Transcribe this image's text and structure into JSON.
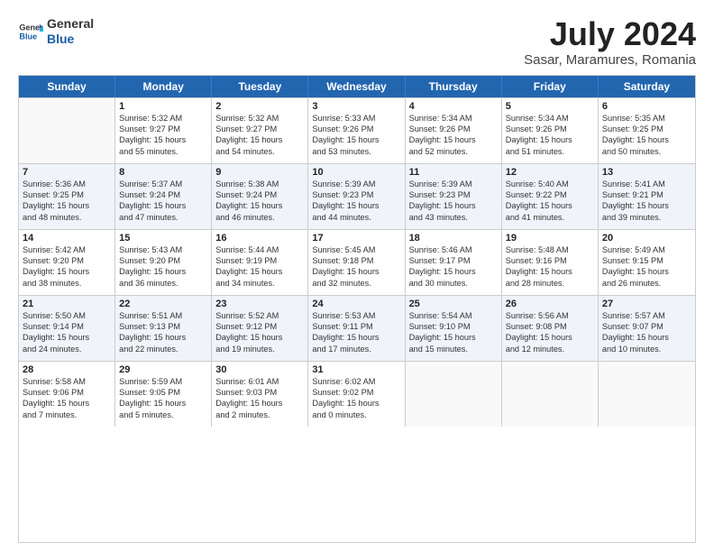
{
  "header": {
    "logo_line1": "General",
    "logo_line2": "Blue",
    "title": "July 2024",
    "subtitle": "Sasar, Maramures, Romania"
  },
  "weekdays": [
    "Sunday",
    "Monday",
    "Tuesday",
    "Wednesday",
    "Thursday",
    "Friday",
    "Saturday"
  ],
  "weeks": [
    [
      {
        "day": "",
        "lines": [],
        "empty": true
      },
      {
        "day": "1",
        "lines": [
          "Sunrise: 5:32 AM",
          "Sunset: 9:27 PM",
          "Daylight: 15 hours",
          "and 55 minutes."
        ]
      },
      {
        "day": "2",
        "lines": [
          "Sunrise: 5:32 AM",
          "Sunset: 9:27 PM",
          "Daylight: 15 hours",
          "and 54 minutes."
        ]
      },
      {
        "day": "3",
        "lines": [
          "Sunrise: 5:33 AM",
          "Sunset: 9:26 PM",
          "Daylight: 15 hours",
          "and 53 minutes."
        ]
      },
      {
        "day": "4",
        "lines": [
          "Sunrise: 5:34 AM",
          "Sunset: 9:26 PM",
          "Daylight: 15 hours",
          "and 52 minutes."
        ]
      },
      {
        "day": "5",
        "lines": [
          "Sunrise: 5:34 AM",
          "Sunset: 9:26 PM",
          "Daylight: 15 hours",
          "and 51 minutes."
        ]
      },
      {
        "day": "6",
        "lines": [
          "Sunrise: 5:35 AM",
          "Sunset: 9:25 PM",
          "Daylight: 15 hours",
          "and 50 minutes."
        ]
      }
    ],
    [
      {
        "day": "7",
        "lines": [
          "Sunrise: 5:36 AM",
          "Sunset: 9:25 PM",
          "Daylight: 15 hours",
          "and 48 minutes."
        ],
        "alt": true
      },
      {
        "day": "8",
        "lines": [
          "Sunrise: 5:37 AM",
          "Sunset: 9:24 PM",
          "Daylight: 15 hours",
          "and 47 minutes."
        ],
        "alt": true
      },
      {
        "day": "9",
        "lines": [
          "Sunrise: 5:38 AM",
          "Sunset: 9:24 PM",
          "Daylight: 15 hours",
          "and 46 minutes."
        ],
        "alt": true
      },
      {
        "day": "10",
        "lines": [
          "Sunrise: 5:39 AM",
          "Sunset: 9:23 PM",
          "Daylight: 15 hours",
          "and 44 minutes."
        ],
        "alt": true
      },
      {
        "day": "11",
        "lines": [
          "Sunrise: 5:39 AM",
          "Sunset: 9:23 PM",
          "Daylight: 15 hours",
          "and 43 minutes."
        ],
        "alt": true
      },
      {
        "day": "12",
        "lines": [
          "Sunrise: 5:40 AM",
          "Sunset: 9:22 PM",
          "Daylight: 15 hours",
          "and 41 minutes."
        ],
        "alt": true
      },
      {
        "day": "13",
        "lines": [
          "Sunrise: 5:41 AM",
          "Sunset: 9:21 PM",
          "Daylight: 15 hours",
          "and 39 minutes."
        ],
        "alt": true
      }
    ],
    [
      {
        "day": "14",
        "lines": [
          "Sunrise: 5:42 AM",
          "Sunset: 9:20 PM",
          "Daylight: 15 hours",
          "and 38 minutes."
        ]
      },
      {
        "day": "15",
        "lines": [
          "Sunrise: 5:43 AM",
          "Sunset: 9:20 PM",
          "Daylight: 15 hours",
          "and 36 minutes."
        ]
      },
      {
        "day": "16",
        "lines": [
          "Sunrise: 5:44 AM",
          "Sunset: 9:19 PM",
          "Daylight: 15 hours",
          "and 34 minutes."
        ]
      },
      {
        "day": "17",
        "lines": [
          "Sunrise: 5:45 AM",
          "Sunset: 9:18 PM",
          "Daylight: 15 hours",
          "and 32 minutes."
        ]
      },
      {
        "day": "18",
        "lines": [
          "Sunrise: 5:46 AM",
          "Sunset: 9:17 PM",
          "Daylight: 15 hours",
          "and 30 minutes."
        ]
      },
      {
        "day": "19",
        "lines": [
          "Sunrise: 5:48 AM",
          "Sunset: 9:16 PM",
          "Daylight: 15 hours",
          "and 28 minutes."
        ]
      },
      {
        "day": "20",
        "lines": [
          "Sunrise: 5:49 AM",
          "Sunset: 9:15 PM",
          "Daylight: 15 hours",
          "and 26 minutes."
        ]
      }
    ],
    [
      {
        "day": "21",
        "lines": [
          "Sunrise: 5:50 AM",
          "Sunset: 9:14 PM",
          "Daylight: 15 hours",
          "and 24 minutes."
        ],
        "alt": true
      },
      {
        "day": "22",
        "lines": [
          "Sunrise: 5:51 AM",
          "Sunset: 9:13 PM",
          "Daylight: 15 hours",
          "and 22 minutes."
        ],
        "alt": true
      },
      {
        "day": "23",
        "lines": [
          "Sunrise: 5:52 AM",
          "Sunset: 9:12 PM",
          "Daylight: 15 hours",
          "and 19 minutes."
        ],
        "alt": true
      },
      {
        "day": "24",
        "lines": [
          "Sunrise: 5:53 AM",
          "Sunset: 9:11 PM",
          "Daylight: 15 hours",
          "and 17 minutes."
        ],
        "alt": true
      },
      {
        "day": "25",
        "lines": [
          "Sunrise: 5:54 AM",
          "Sunset: 9:10 PM",
          "Daylight: 15 hours",
          "and 15 minutes."
        ],
        "alt": true
      },
      {
        "day": "26",
        "lines": [
          "Sunrise: 5:56 AM",
          "Sunset: 9:08 PM",
          "Daylight: 15 hours",
          "and 12 minutes."
        ],
        "alt": true
      },
      {
        "day": "27",
        "lines": [
          "Sunrise: 5:57 AM",
          "Sunset: 9:07 PM",
          "Daylight: 15 hours",
          "and 10 minutes."
        ],
        "alt": true
      }
    ],
    [
      {
        "day": "28",
        "lines": [
          "Sunrise: 5:58 AM",
          "Sunset: 9:06 PM",
          "Daylight: 15 hours",
          "and 7 minutes."
        ]
      },
      {
        "day": "29",
        "lines": [
          "Sunrise: 5:59 AM",
          "Sunset: 9:05 PM",
          "Daylight: 15 hours",
          "and 5 minutes."
        ]
      },
      {
        "day": "30",
        "lines": [
          "Sunrise: 6:01 AM",
          "Sunset: 9:03 PM",
          "Daylight: 15 hours",
          "and 2 minutes."
        ]
      },
      {
        "day": "31",
        "lines": [
          "Sunrise: 6:02 AM",
          "Sunset: 9:02 PM",
          "Daylight: 15 hours",
          "and 0 minutes."
        ]
      },
      {
        "day": "",
        "lines": [],
        "empty": true
      },
      {
        "day": "",
        "lines": [],
        "empty": true
      },
      {
        "day": "",
        "lines": [],
        "empty": true
      }
    ]
  ]
}
